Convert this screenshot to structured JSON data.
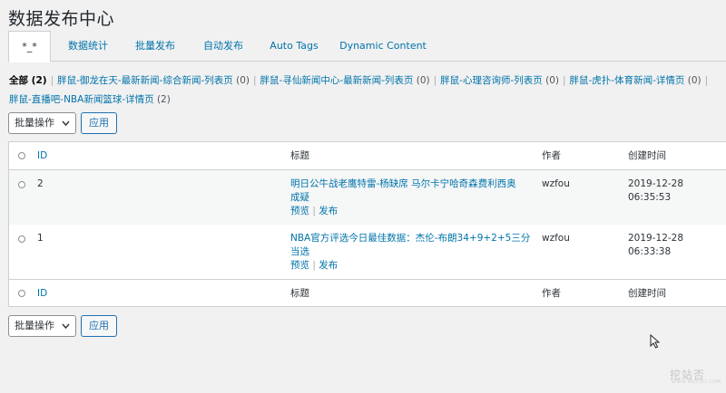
{
  "page_title": "数据发布中心",
  "tabs": [
    {
      "label": "*_*",
      "active": true
    },
    {
      "label": "数据统计"
    },
    {
      "label": "批量发布"
    },
    {
      "label": "自动发布"
    },
    {
      "label": "Auto Tags"
    },
    {
      "label": "Dynamic Content"
    }
  ],
  "filters": [
    {
      "label": "全部",
      "count": "(2)"
    },
    {
      "label": "胖鼠-御龙在天-最新新闻-综合新闻-列表页",
      "count": "(0)"
    },
    {
      "label": "胖鼠-寻仙新闻中心-最新新闻-列表页",
      "count": "(0)"
    },
    {
      "label": "胖鼠-心理咨询师-列表页",
      "count": "(0)"
    },
    {
      "label": "胖鼠-虎扑-体育新闻-详情页",
      "count": "(0)"
    },
    {
      "label": "胖鼠-直播吧-NBA新闻篮球-详情页",
      "count": "(2)"
    }
  ],
  "filter_separator": "|",
  "bulk": {
    "select_label": "批量操作",
    "apply_label": "应用"
  },
  "table": {
    "columns": {
      "id": "ID",
      "title": "标题",
      "author": "作者",
      "created": "创建时间"
    },
    "rows": [
      {
        "id": "2",
        "title_line1": "明日公牛战老鹰特雷-杨缺席 马尔卡宁哈奇森费利西奥",
        "title_line2": "成疑",
        "action_preview": "预览",
        "action_publish": "发布",
        "author": "wzfou",
        "created": "2019-12-28 06:35:53"
      },
      {
        "id": "1",
        "title_line1": "NBA官方评选今日最佳数据：杰伦-布朗34+9+2+5三分",
        "title_line2": "当选",
        "action_preview": "预览",
        "action_publish": "发布",
        "author": "wzfou",
        "created": "2019-12-28 06:33:38"
      }
    ]
  },
  "watermark": {
    "text": "挖站否",
    "sub": "WWW.WZFOU.COM"
  }
}
